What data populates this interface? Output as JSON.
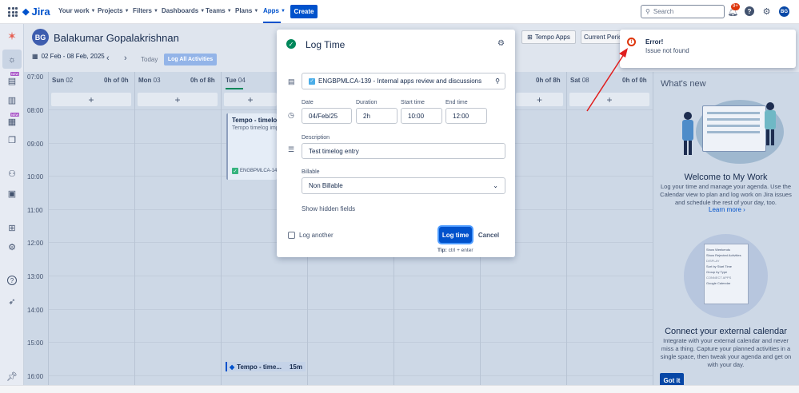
{
  "nav": {
    "logo": "Jira",
    "items": [
      "Your work",
      "Projects",
      "Filters",
      "Dashboards",
      "Teams",
      "Plans",
      "Apps"
    ],
    "create": "Create",
    "search_placeholder": "Search",
    "notifications_badge": "9+",
    "avatar": "BG"
  },
  "header": {
    "avatar": "BG",
    "user_name": "Balakumar Gopalakrishnan",
    "tempo_apps": "Tempo Apps",
    "current_period": "Current Period"
  },
  "toolbar": {
    "date_range": "02 Feb - 08 Feb, 2025",
    "today": "Today",
    "log_all": "Log All Activities"
  },
  "calendar": {
    "times": [
      "07:00",
      "08:00",
      "09:00",
      "10:00",
      "11:00",
      "12:00",
      "13:00",
      "14:00",
      "15:00",
      "16:00"
    ],
    "days": [
      {
        "name": "Sun",
        "num": "02",
        "total": "0h of 0h"
      },
      {
        "name": "Mon",
        "num": "03",
        "total": "0h of 8h"
      },
      {
        "name": "Tue",
        "num": "04",
        "total": ""
      },
      {
        "name": "",
        "num": "",
        "total": "0h of 8h"
      },
      {
        "name": "Sat",
        "num": "08",
        "total": "0h of 0h"
      }
    ],
    "event_title": "Tempo - timelog",
    "event_sub": "Tempo timelog impo",
    "event_key": "ENGBPMLCA-14",
    "bottom_event": "Tempo - time...",
    "bottom_event_dur": "15m"
  },
  "right_panel": {
    "whats_new": "What's new",
    "welcome_title": "Welcome to My Work",
    "welcome_text": "Log your time and manage your agenda. Use the Calendar view to plan and log work on Jira issues and schedule the rest of your day, too.",
    "learn_more": "Learn more",
    "connect_title": "Connect your external calendar",
    "connect_text": "Integrate with your external calendar and never miss a thing. Capture your planned activities in a single space, then tweak your agenda and get on with your day.",
    "got_it": "Got it",
    "mini_menu": [
      "Show Weekends",
      "Show Rejected Activities",
      "DISPLAY",
      "Sort by Start Time",
      "Group by Type",
      "CONNECT APPS",
      "Google Calendar"
    ]
  },
  "modal": {
    "title": "Log Time",
    "issue": "ENGBPMLCA-139 - Internal apps review and discussions",
    "date_label": "Date",
    "date_value": "04/Feb/25",
    "duration_label": "Duration",
    "duration_value": "2h",
    "start_label": "Start time",
    "start_value": "10:00",
    "end_label": "End time",
    "end_value": "12:00",
    "description_label": "Description",
    "description_value": "Test timelog entry",
    "billable_label": "Billable",
    "billable_value": "Non Billable",
    "show_hidden": "Show hidden fields",
    "log_another": "Log another",
    "log_time_btn": "Log time",
    "cancel_btn": "Cancel",
    "tip_label": "Tip:",
    "tip_value": "ctrl + enter"
  },
  "error": {
    "title": "Error!",
    "message": "Issue not found"
  },
  "colors": {
    "brand": "#0052cc",
    "error": "#de350b",
    "success": "#00875a"
  }
}
